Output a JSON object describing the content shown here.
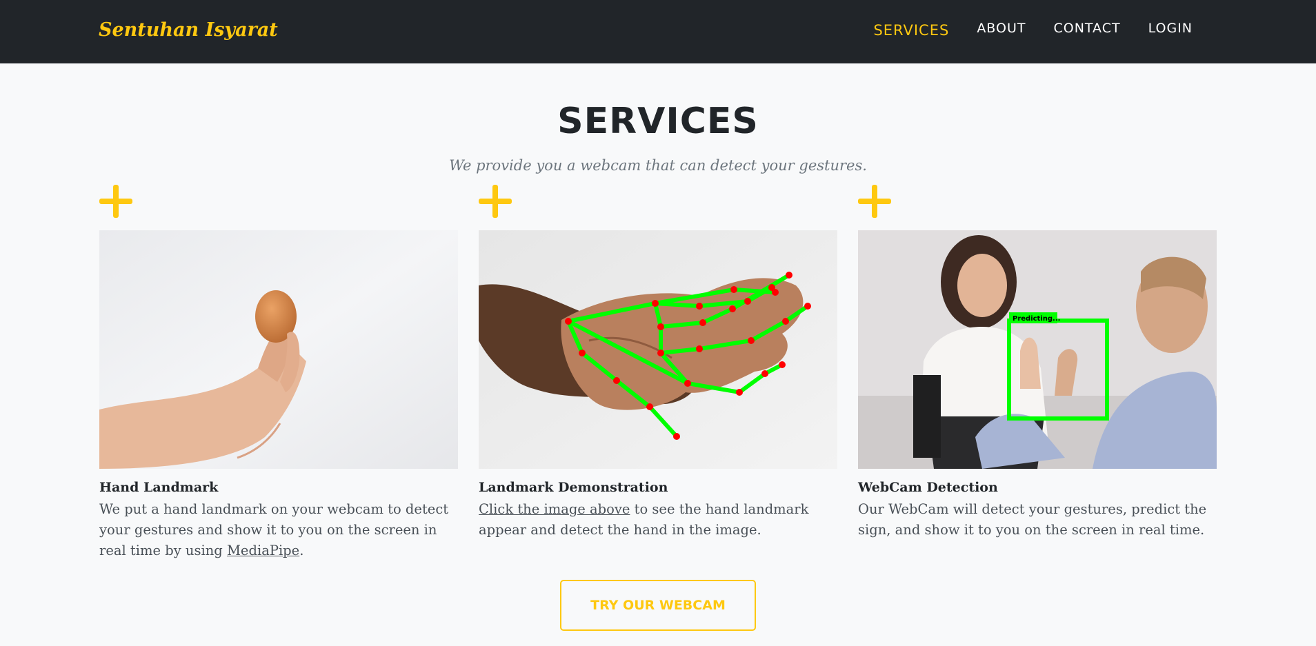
{
  "navbar": {
    "brand": "Sentuhan Isyarat",
    "links": [
      {
        "label": "SERVICES",
        "active": true
      },
      {
        "label": "ABOUT"
      },
      {
        "label": "CONTACT"
      },
      {
        "label": "LOGIN"
      }
    ]
  },
  "services": {
    "heading": "SERVICES",
    "subheading": "We provide you a webcam that can detect your gestures.",
    "items": [
      {
        "title": "Hand Landmark",
        "desc_before": "We put a hand landmark on your webcam to detect your gestures and show it to you on the screen in real time by using ",
        "link": "MediaPipe",
        "desc_after": "."
      },
      {
        "title": "Landmark Demonstration",
        "link": "Click the image above",
        "desc_after": " to see the hand landmark appear and detect the hand in the image."
      },
      {
        "title": "WebCam Detection",
        "desc": "Our WebCam will detect your gestures, predict the sign, and show it to you on the screen in real time.",
        "overlay_label": "Predicting..."
      }
    ],
    "button": "TRY OUR WEBCAM"
  },
  "colors": {
    "accent": "#fec810",
    "navbar_bg": "#212529",
    "landmark_line": "#00ff00",
    "landmark_point": "#ff0000"
  }
}
